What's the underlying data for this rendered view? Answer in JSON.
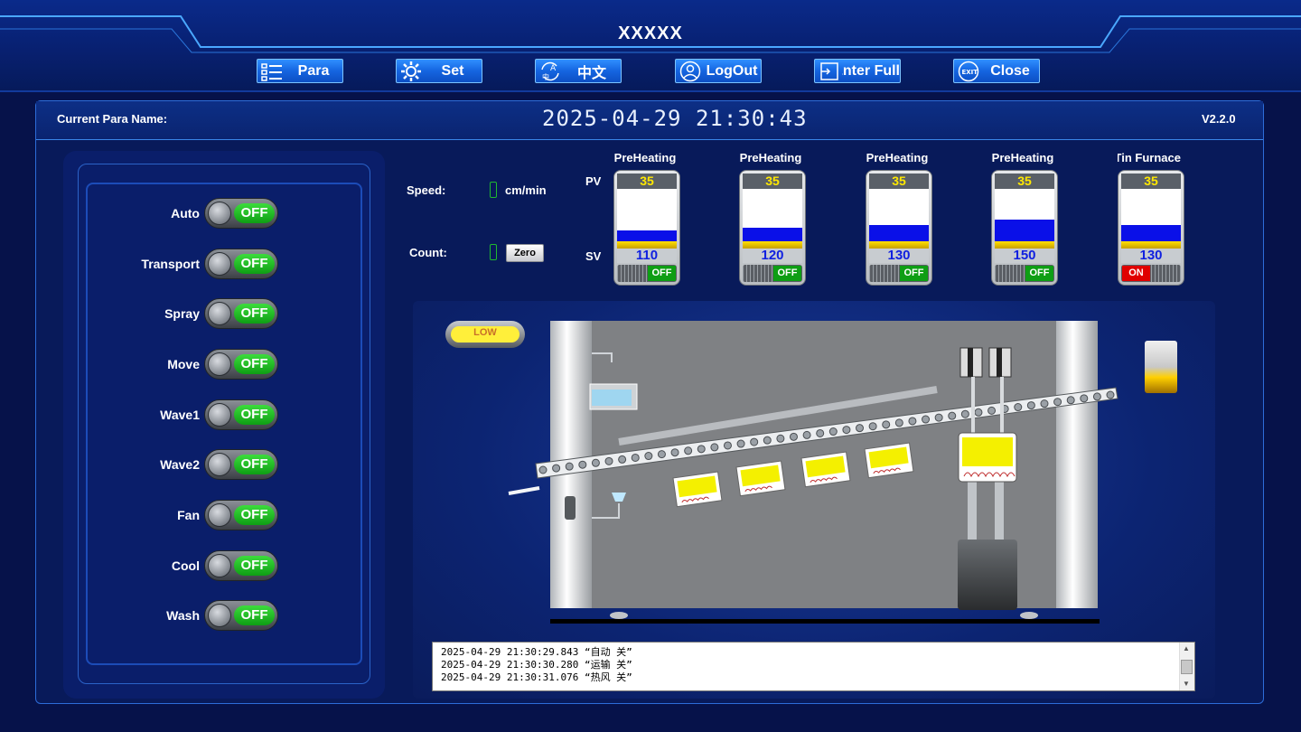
{
  "header": {
    "title": "XXXXX",
    "nav": [
      {
        "label": "Para",
        "icon": "list-icon"
      },
      {
        "label": "Set",
        "icon": "gear-icon"
      },
      {
        "label": "中文",
        "icon": "language-icon"
      },
      {
        "label": "LogOut",
        "icon": "user-icon"
      },
      {
        "label": "Enter Full",
        "icon": "fullscreen-icon"
      },
      {
        "label": "Close",
        "icon": "exit-icon"
      }
    ]
  },
  "info": {
    "para_name_label": "Current Para Name:",
    "datetime": "2025-04-29 21:30:43",
    "version": "V2.2.0"
  },
  "switches": [
    {
      "label": "Auto",
      "state": "OFF"
    },
    {
      "label": "Transport",
      "state": "OFF"
    },
    {
      "label": "Spray",
      "state": "OFF"
    },
    {
      "label": "Move",
      "state": "OFF"
    },
    {
      "label": "Wave1",
      "state": "OFF"
    },
    {
      "label": "Wave2",
      "state": "OFF"
    },
    {
      "label": "Fan",
      "state": "OFF"
    },
    {
      "label": "Cool",
      "state": "OFF"
    },
    {
      "label": "Wash",
      "state": "OFF"
    }
  ],
  "status": {
    "speed_label": "Speed:",
    "speed_unit": "cm/min",
    "count_label": "Count:",
    "zero_label": "Zero"
  },
  "heaters": {
    "pv_label": "PV",
    "sv_label": "SV",
    "items": [
      {
        "title": "PreHeating",
        "pv": "35",
        "sv": "110",
        "state": "OFF",
        "level": 0.3
      },
      {
        "title": "PreHeating",
        "pv": "35",
        "sv": "120",
        "state": "OFF",
        "level": 0.35
      },
      {
        "title": "PreHeating",
        "pv": "35",
        "sv": "130",
        "state": "OFF",
        "level": 0.4
      },
      {
        "title": "PreHeating",
        "pv": "35",
        "sv": "150",
        "state": "OFF",
        "level": 0.48
      },
      {
        "title": "Tin Furnace",
        "pv": "35",
        "sv": "130",
        "state": "ON",
        "level": 0.4
      }
    ]
  },
  "machine": {
    "level_indicator": "LOW"
  },
  "log": [
    "2025-04-29 21:30:29.843 “自动 关”",
    "2025-04-29 21:30:30.280 “运输 关”",
    "2025-04-29 21:30:31.076 “热风 关”"
  ],
  "colors": {
    "bg": "#06124a",
    "accent": "#1565e0",
    "on_green": "#0e9e14",
    "on_red": "#e00000",
    "gauge_pv": "#ffe800",
    "gauge_fill": "#0a10e8"
  }
}
